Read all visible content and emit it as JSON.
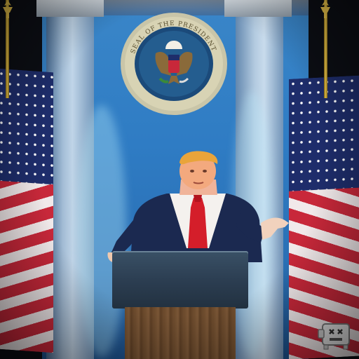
{
  "scene": {
    "description_free": true,
    "colors": {
      "backdrop": "#2f7cc4",
      "flag_red": "#c8283a",
      "flag_white": "#f1e9ea",
      "flag_blue": "#1e2d6b",
      "suit": "#1b2950",
      "tie": "#d41e2a",
      "podium_top": "#2c3e52",
      "podium_wood": "#6b4a2c",
      "seal_blue": "#1b4a7a",
      "gold": "#e8c24a"
    },
    "icons": {
      "seal": "presidential-seal-icon",
      "eagle": "eagle-icon",
      "watermark": "robot-face-icon"
    }
  }
}
